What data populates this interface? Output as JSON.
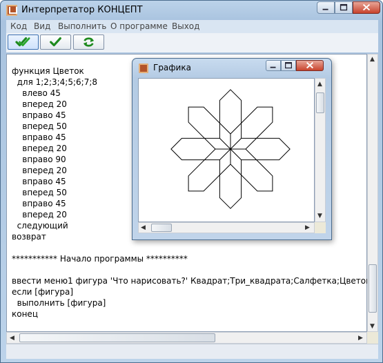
{
  "window": {
    "title": "Интерпретатор КОНЦЕПТ"
  },
  "menu": {
    "items": [
      {
        "label": "Код"
      },
      {
        "label": "Вид"
      },
      {
        "label": "Выполнить"
      },
      {
        "label": "О программе"
      },
      {
        "label": "Выход"
      }
    ]
  },
  "toolbar": {
    "buttons": [
      {
        "icon": "double-check-icon",
        "color": "#1e8a1e"
      },
      {
        "icon": "check-icon",
        "color": "#1e8a1e"
      },
      {
        "icon": "refresh-icon",
        "color": "#1e8a1e"
      }
    ]
  },
  "editor": {
    "lines": [
      "функция Цветок",
      "  для 1;2;3;4;5;6;7;8",
      "    влево 45",
      "    вперед 20",
      "    вправо 45",
      "    вперед 50",
      "    вправо 45",
      "    вперед 20",
      "    вправо 90",
      "    вперед 20",
      "    вправо 45",
      "    вперед 50",
      "    вправо 45",
      "    вперед 20",
      "  следующий",
      "возврат",
      "",
      "*********** Начало программы **********",
      "",
      "ввести меню1 фигура 'Что нарисовать?' Квадрат;Три_квадрата;Салфетка;Цветок",
      "если [фигура]",
      "  выполнить [фигура]",
      "конец"
    ]
  },
  "graphics_window": {
    "title": "Графика",
    "drawing": "flower-turtle-drawing",
    "stroke_color": "#000000"
  }
}
